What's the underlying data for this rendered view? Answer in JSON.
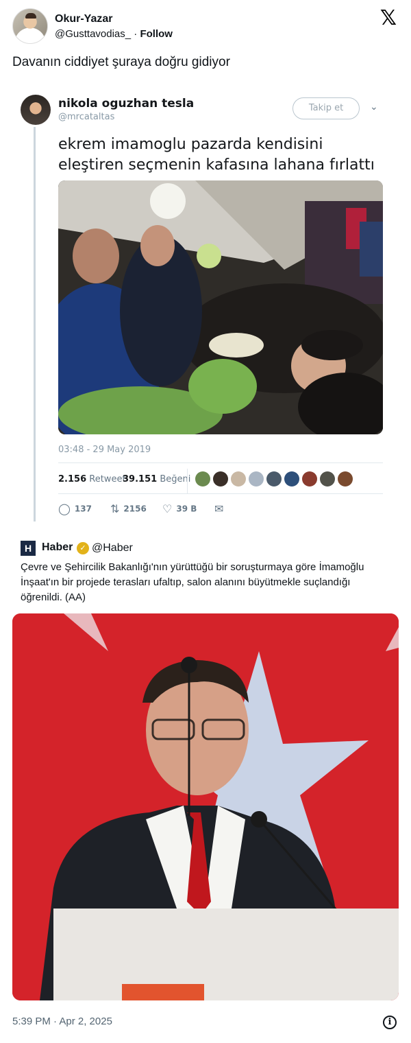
{
  "tweet": {
    "author_name": "Okur-Yazar",
    "handle": "@Gusttavodias_",
    "separator": "·",
    "follow_label": "Follow",
    "text": "Davanın ciddiyet şuraya doğru gidiyor",
    "timestamp": "5:39 PM · Apr 2, 2025"
  },
  "quoted_old_tweet": {
    "name": "nikola oguzhan tesla",
    "handle": "@mrcataltas",
    "follow_label": "Takip et",
    "text": "ekrem imamoglu pazarda kendisini eleştiren seçmenin kafasına lahana fırlattı",
    "time": "03:48 - 29 May 2019",
    "retweet_count": "2.156",
    "retweet_label": "Retweet",
    "like_count": "39.151",
    "like_label": "Beğeni",
    "actions": {
      "reply": "137",
      "retweet": "2156",
      "like": "39 B"
    }
  },
  "news": {
    "logo_letter": "H",
    "name": "Haber",
    "handle": "@Haber",
    "text": "Çevre ve Şehircilik Bakanlığı'nın yürüttüğü bir soruşturmaya göre İmamoğlu İnşaat'ın bir projede terasları ufaltıp, salon alanını büyütmekle suçlandığı öğrenildi. (AA)"
  },
  "icons": {
    "x_logo": "x-logo-icon",
    "info": "info-icon",
    "verified": "verified-badge-icon"
  },
  "colors": {
    "portrait_background": "#d4232a",
    "news_logo": "#1a2944",
    "verified_badge": "#e2b21a"
  }
}
